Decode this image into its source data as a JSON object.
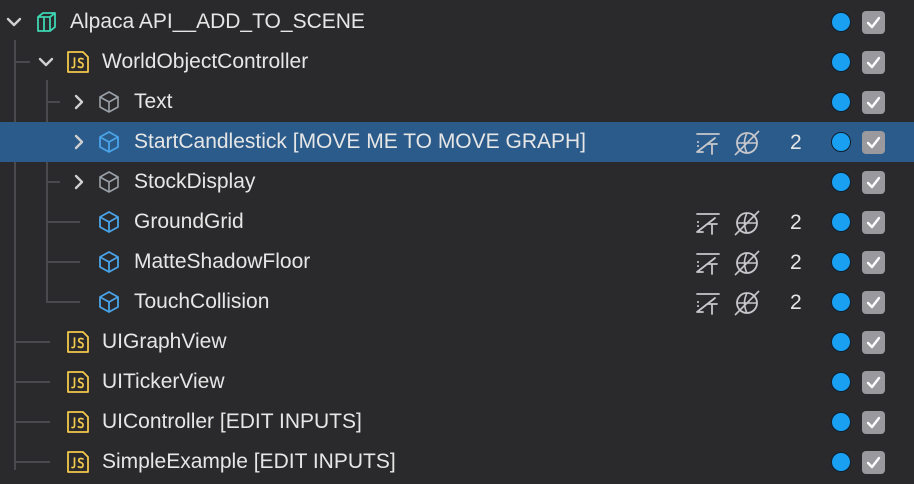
{
  "colors": {
    "background": "#2a2a2c",
    "selected_row": "#2b5b8a",
    "dot": "#19a0f2",
    "js_icon": "#f2c94c",
    "object_icon": "#4aa3e8",
    "text": "#e6e6e6"
  },
  "rows": [
    {
      "label": "Alpaca API__ADD_TO_SCENE",
      "icon": "prefab-icon",
      "expanded": true,
      "count": null
    },
    {
      "label": "WorldObjectController",
      "icon": "js-script-icon",
      "expanded": true,
      "count": null
    },
    {
      "label": "Text",
      "icon": "object-icon",
      "expanded": false,
      "count": null
    },
    {
      "label": "StartCandlestick [MOVE ME TO MOVE GRAPH]",
      "icon": "object-icon",
      "expanded": false,
      "count": "2",
      "selected": true
    },
    {
      "label": "StockDisplay",
      "icon": "object-icon",
      "expanded": false,
      "count": null
    },
    {
      "label": "GroundGrid",
      "icon": "object-icon",
      "count": "2"
    },
    {
      "label": "MatteShadowFloor",
      "icon": "object-icon",
      "count": "2"
    },
    {
      "label": "TouchCollision",
      "icon": "object-icon",
      "count": "2"
    },
    {
      "label": "UIGraphView",
      "icon": "js-script-icon",
      "count": null
    },
    {
      "label": "UITickerView",
      "icon": "js-script-icon",
      "count": null
    },
    {
      "label": "UIController [EDIT INPUTS]",
      "icon": "js-script-icon",
      "count": null
    },
    {
      "label": "SimpleExample [EDIT INPUTS]",
      "icon": "js-script-icon",
      "count": null
    }
  ]
}
